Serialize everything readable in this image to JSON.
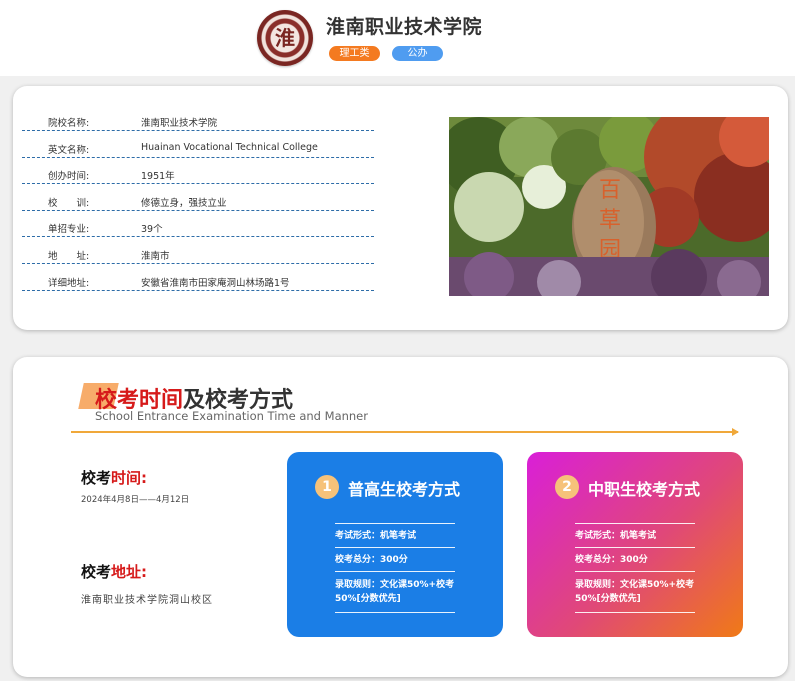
{
  "header": {
    "school_name": "淮南职业技术学院",
    "tags": [
      "理工类",
      "公办"
    ],
    "logo_icon": "school-seal-icon"
  },
  "info": {
    "rows": [
      {
        "label": "院校名称:",
        "value": "淮南职业技术学院"
      },
      {
        "label": "英文名称:",
        "value": "Huainan Vocational Technical College"
      },
      {
        "label": "创办时间:",
        "value": "1951年"
      },
      {
        "label": "校　　训:",
        "value": "修德立身，强技立业"
      },
      {
        "label": "单招专业:",
        "value": "39个"
      },
      {
        "label": "地　　址:",
        "value": "淮南市"
      },
      {
        "label": "详细地址:",
        "value": "安徽省淮南市田家庵洞山林场路1号"
      }
    ],
    "photo": "campus-stone-garden-photo"
  },
  "exam": {
    "title_red": "校考时间",
    "title_rest": "及校考方式",
    "subtitle": "School Entrance Examination Time and Manner",
    "time_head_a": "校考",
    "time_head_b": "时间:",
    "time_value": "2024年4月8日——4月12日",
    "addr_head_a": "校考",
    "addr_head_b": "地址:",
    "addr_value": "淮南职业技术学院洞山校区",
    "panels": [
      {
        "num": "1",
        "title": "普高生校考方式",
        "items": [
          "考试形式：机笔考试",
          "校考总分：300分",
          "录取规则：文化课50%+校考50%[分数优先]"
        ]
      },
      {
        "num": "2",
        "title": "中职生校考方式",
        "items": [
          "考试形式：机笔考试",
          "校考总分：300分",
          "录取规则：文化课50%+校考50%[分数优先]"
        ]
      }
    ]
  },
  "colors": {
    "accent_orange": "#f47a20",
    "accent_blue": "#1b7ee6",
    "accent_red": "#d61a1a"
  }
}
